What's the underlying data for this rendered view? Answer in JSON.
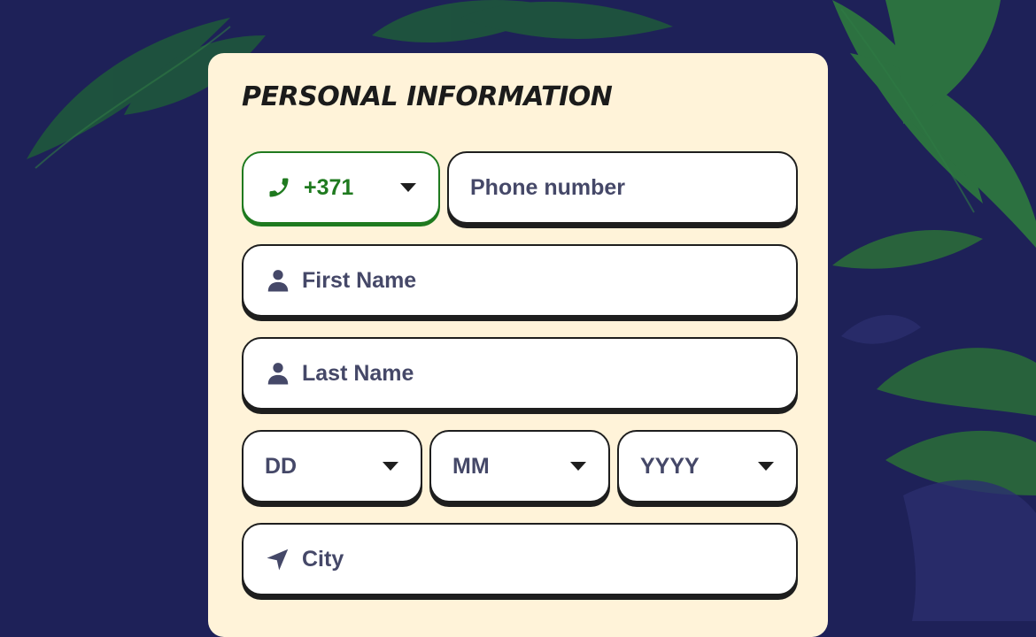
{
  "form": {
    "title": "PERSONAL INFORMATION",
    "phone_code": "+371",
    "phone_placeholder": "Phone number",
    "first_name_placeholder": "First Name",
    "last_name_placeholder": "Last Name",
    "day_placeholder": "DD",
    "month_placeholder": "MM",
    "year_placeholder": "YYYY",
    "city_placeholder": "City"
  },
  "colors": {
    "background": "#1e2158",
    "card": "#fff3d9",
    "accent_green": "#1f7a1f",
    "field_text": "#454868"
  },
  "icons": [
    "phone-icon",
    "user-icon",
    "location-arrow-icon",
    "caret-down-icon"
  ]
}
